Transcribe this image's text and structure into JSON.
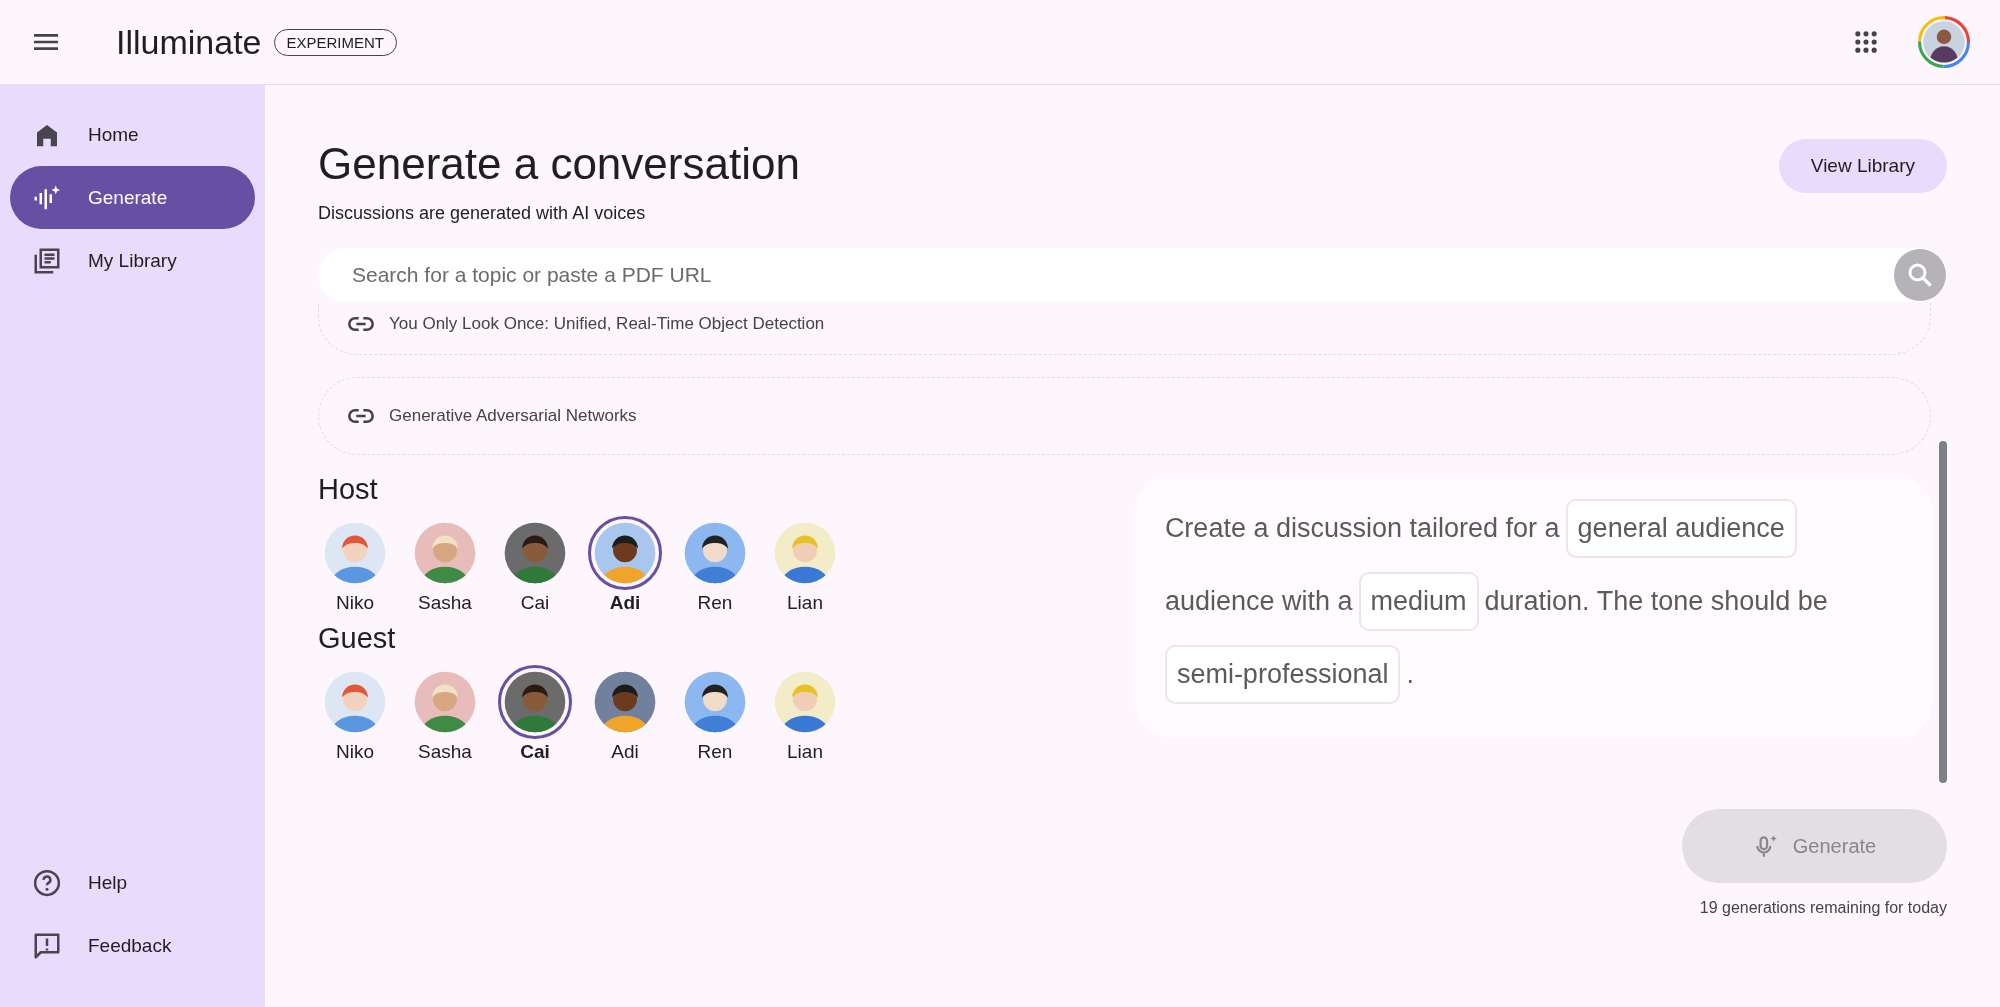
{
  "app": {
    "title": "Illuminate",
    "badge": "EXPERIMENT"
  },
  "sidebar": {
    "items": [
      {
        "label": "Home",
        "kind": "home",
        "selected": false
      },
      {
        "label": "Generate",
        "kind": "generate",
        "selected": true
      },
      {
        "label": "My Library",
        "kind": "library",
        "selected": false
      }
    ],
    "footer_items": [
      {
        "label": "Help",
        "kind": "help"
      },
      {
        "label": "Feedback",
        "kind": "feedback"
      }
    ]
  },
  "page": {
    "title": "Generate a conversation",
    "subtitle": "Discussions are generated with AI voices",
    "view_library": "View Library"
  },
  "search": {
    "placeholder": "Search for a topic or paste a PDF URL"
  },
  "sources": [
    {
      "title": "You Only Look Once: Unified, Real-Time Object Detection"
    },
    {
      "title": "Generative Adversarial Networks"
    }
  ],
  "voice_groups": [
    {
      "label": "Host",
      "voices": [
        {
          "name": "Niko",
          "selected": false
        },
        {
          "name": "Sasha",
          "selected": false
        },
        {
          "name": "Cai",
          "selected": false
        },
        {
          "name": "Adi",
          "selected": true
        },
        {
          "name": "Ren",
          "selected": false
        },
        {
          "name": "Lian",
          "selected": false
        }
      ]
    },
    {
      "label": "Guest",
      "voices": [
        {
          "name": "Niko",
          "selected": false
        },
        {
          "name": "Sasha",
          "selected": false
        },
        {
          "name": "Cai",
          "selected": true
        },
        {
          "name": "Adi",
          "selected": false
        },
        {
          "name": "Ren",
          "selected": false
        },
        {
          "name": "Lian",
          "selected": false
        }
      ]
    }
  ],
  "prompt": [
    {
      "kind": "text",
      "text": "Create a discussion tailored for a"
    },
    {
      "kind": "chip",
      "text": "general audience"
    },
    {
      "kind": "text",
      "text": "audience with a"
    },
    {
      "kind": "chip",
      "text": "medium"
    },
    {
      "kind": "text",
      "text": "duration. The tone should be"
    },
    {
      "kind": "chip",
      "text": "semi-professional"
    },
    {
      "kind": "text",
      "text": "."
    }
  ],
  "generate": {
    "label": "Generate",
    "disabled": true,
    "remaining": "19 generations remaining for today"
  }
}
